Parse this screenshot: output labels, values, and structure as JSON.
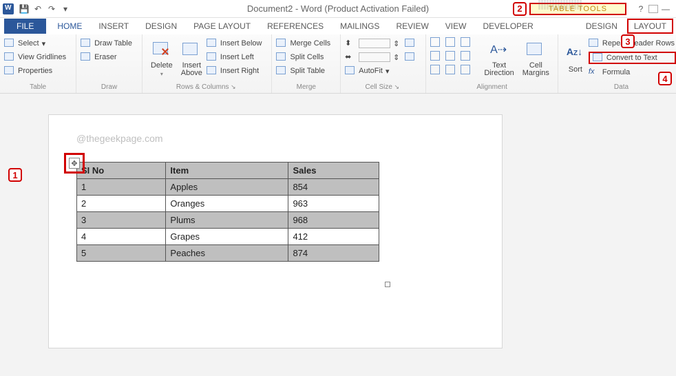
{
  "app": {
    "title": "Document2 - Word (Product Activation Failed)"
  },
  "titlebar": {
    "table_tools": "TABLE TOOLS"
  },
  "tabs": {
    "file": "FILE",
    "home": "HOME",
    "insert": "INSERT",
    "design_doc": "DESIGN",
    "page_layout": "PAGE LAYOUT",
    "references": "REFERENCES",
    "mailings": "MAILINGS",
    "review": "REVIEW",
    "view": "VIEW",
    "developer": "DEVELOPER",
    "design": "DESIGN",
    "layout": "LAYOUT"
  },
  "ribbon": {
    "table": {
      "label": "Table",
      "select": "Select",
      "gridlines": "View Gridlines",
      "properties": "Properties"
    },
    "draw": {
      "label": "Draw",
      "draw_table": "Draw Table",
      "eraser": "Eraser"
    },
    "rows_cols": {
      "label": "Rows & Columns",
      "delete": "Delete",
      "insert_above": "Insert Above",
      "insert_below": "Insert Below",
      "insert_left": "Insert Left",
      "insert_right": "Insert Right"
    },
    "merge": {
      "label": "Merge",
      "merge_cells": "Merge Cells",
      "split_cells": "Split Cells",
      "split_table": "Split Table"
    },
    "cellsize": {
      "label": "Cell Size",
      "autofit": "AutoFit"
    },
    "alignment": {
      "label": "Alignment",
      "text_direction": "Text Direction",
      "cell_margins": "Cell Margins"
    },
    "data_group": {
      "label": "Data",
      "sort": "Sort",
      "repeat": "Repeat Header Rows",
      "convert": "Convert to Text",
      "formula": "Formula"
    }
  },
  "markers": {
    "m1": "1",
    "m2": "2",
    "m3": "3",
    "m4": "4"
  },
  "document": {
    "watermark": "@thegeekpage.com",
    "headers": [
      "SI No",
      "Item",
      "Sales"
    ],
    "rows": [
      {
        "no": "1",
        "item": "Apples",
        "sales": "854"
      },
      {
        "no": "2",
        "item": "Oranges",
        "sales": "963"
      },
      {
        "no": "3",
        "item": "Plums",
        "sales": "968"
      },
      {
        "no": "4",
        "item": "Grapes",
        "sales": "412"
      },
      {
        "no": "5",
        "item": "Peaches",
        "sales": "874"
      }
    ]
  },
  "chart_data": {
    "type": "table",
    "columns": [
      "SI No",
      "Item",
      "Sales"
    ],
    "rows": [
      [
        "1",
        "Apples",
        854
      ],
      [
        "2",
        "Oranges",
        963
      ],
      [
        "3",
        "Plums",
        968
      ],
      [
        "4",
        "Grapes",
        412
      ],
      [
        "5",
        "Peaches",
        874
      ]
    ]
  }
}
